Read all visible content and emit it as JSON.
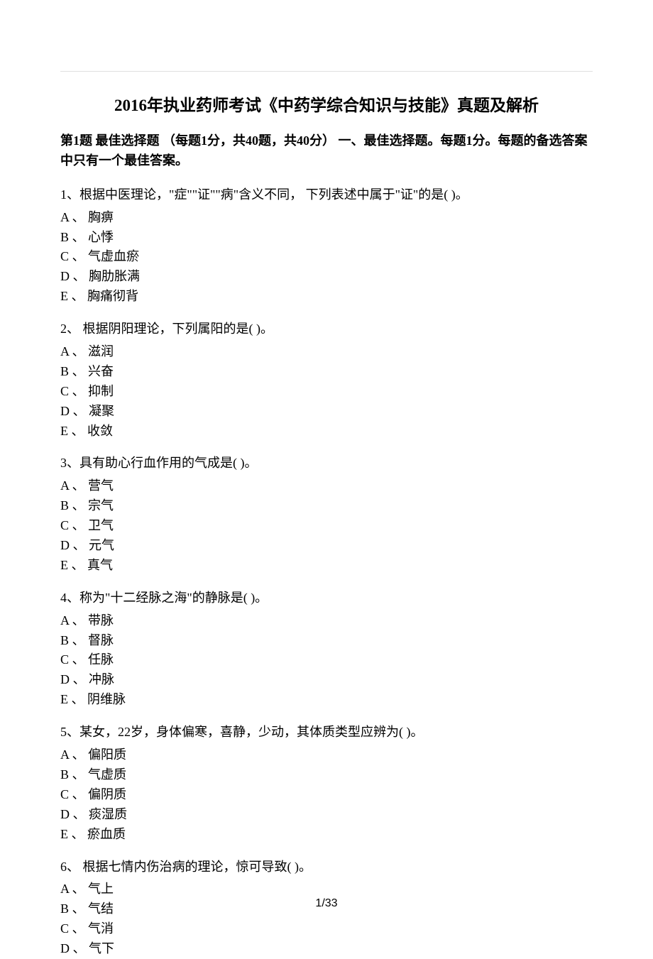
{
  "title": "2016年执业药师考试《中药学综合知识与技能》真题及解析",
  "sectionHeader": "第1题 最佳选择题 （每题1分，共40题，共40分） 一、最佳选择题。每题1分。每题的备选答案中只有一个最佳答案。",
  "questions": [
    {
      "stem": "1、根据中医理论，\"症\"\"证\"\"病\"含义不同， 下列表述中属于\"证\"的是(    )。",
      "options": [
        "A 、 胸痹",
        "B 、 心悸",
        "C 、 气虚血瘀",
        "D 、 胸肋胀满",
        "E 、 胸痛彻背"
      ]
    },
    {
      "stem": "2、 根据阴阳理论，下列属阳的是(    )。",
      "options": [
        "A 、 滋润",
        "B 、 兴奋",
        "C 、 抑制",
        "D 、 凝聚",
        "E 、 收敛"
      ]
    },
    {
      "stem": "3、具有助心行血作用的气成是(    )。",
      "options": [
        "A 、 营气",
        "B 、 宗气",
        "C 、 卫气",
        "D 、 元气",
        "E 、 真气"
      ]
    },
    {
      "stem": "4、称为\"十二经脉之海\"的静脉是(    )。",
      "options": [
        "A 、 带脉",
        "B 、 督脉",
        "C 、 任脉",
        "D 、 冲脉",
        "E 、 阴维脉"
      ]
    },
    {
      "stem": "5、某女，22岁，身体偏寒，喜静，少动，其体质类型应辨为(    )。",
      "options": [
        "A 、 偏阳质",
        "B 、 气虚质",
        "C 、 偏阴质",
        "D 、 痰湿质",
        "E 、 瘀血质"
      ]
    },
    {
      "stem": "6、 根据七情内伤治病的理论，惊可导致(    )。",
      "options": [
        "A 、 气上",
        "B 、 气结",
        "C 、 气消",
        "D 、 气下"
      ]
    }
  ],
  "pageNumber": "1/33"
}
